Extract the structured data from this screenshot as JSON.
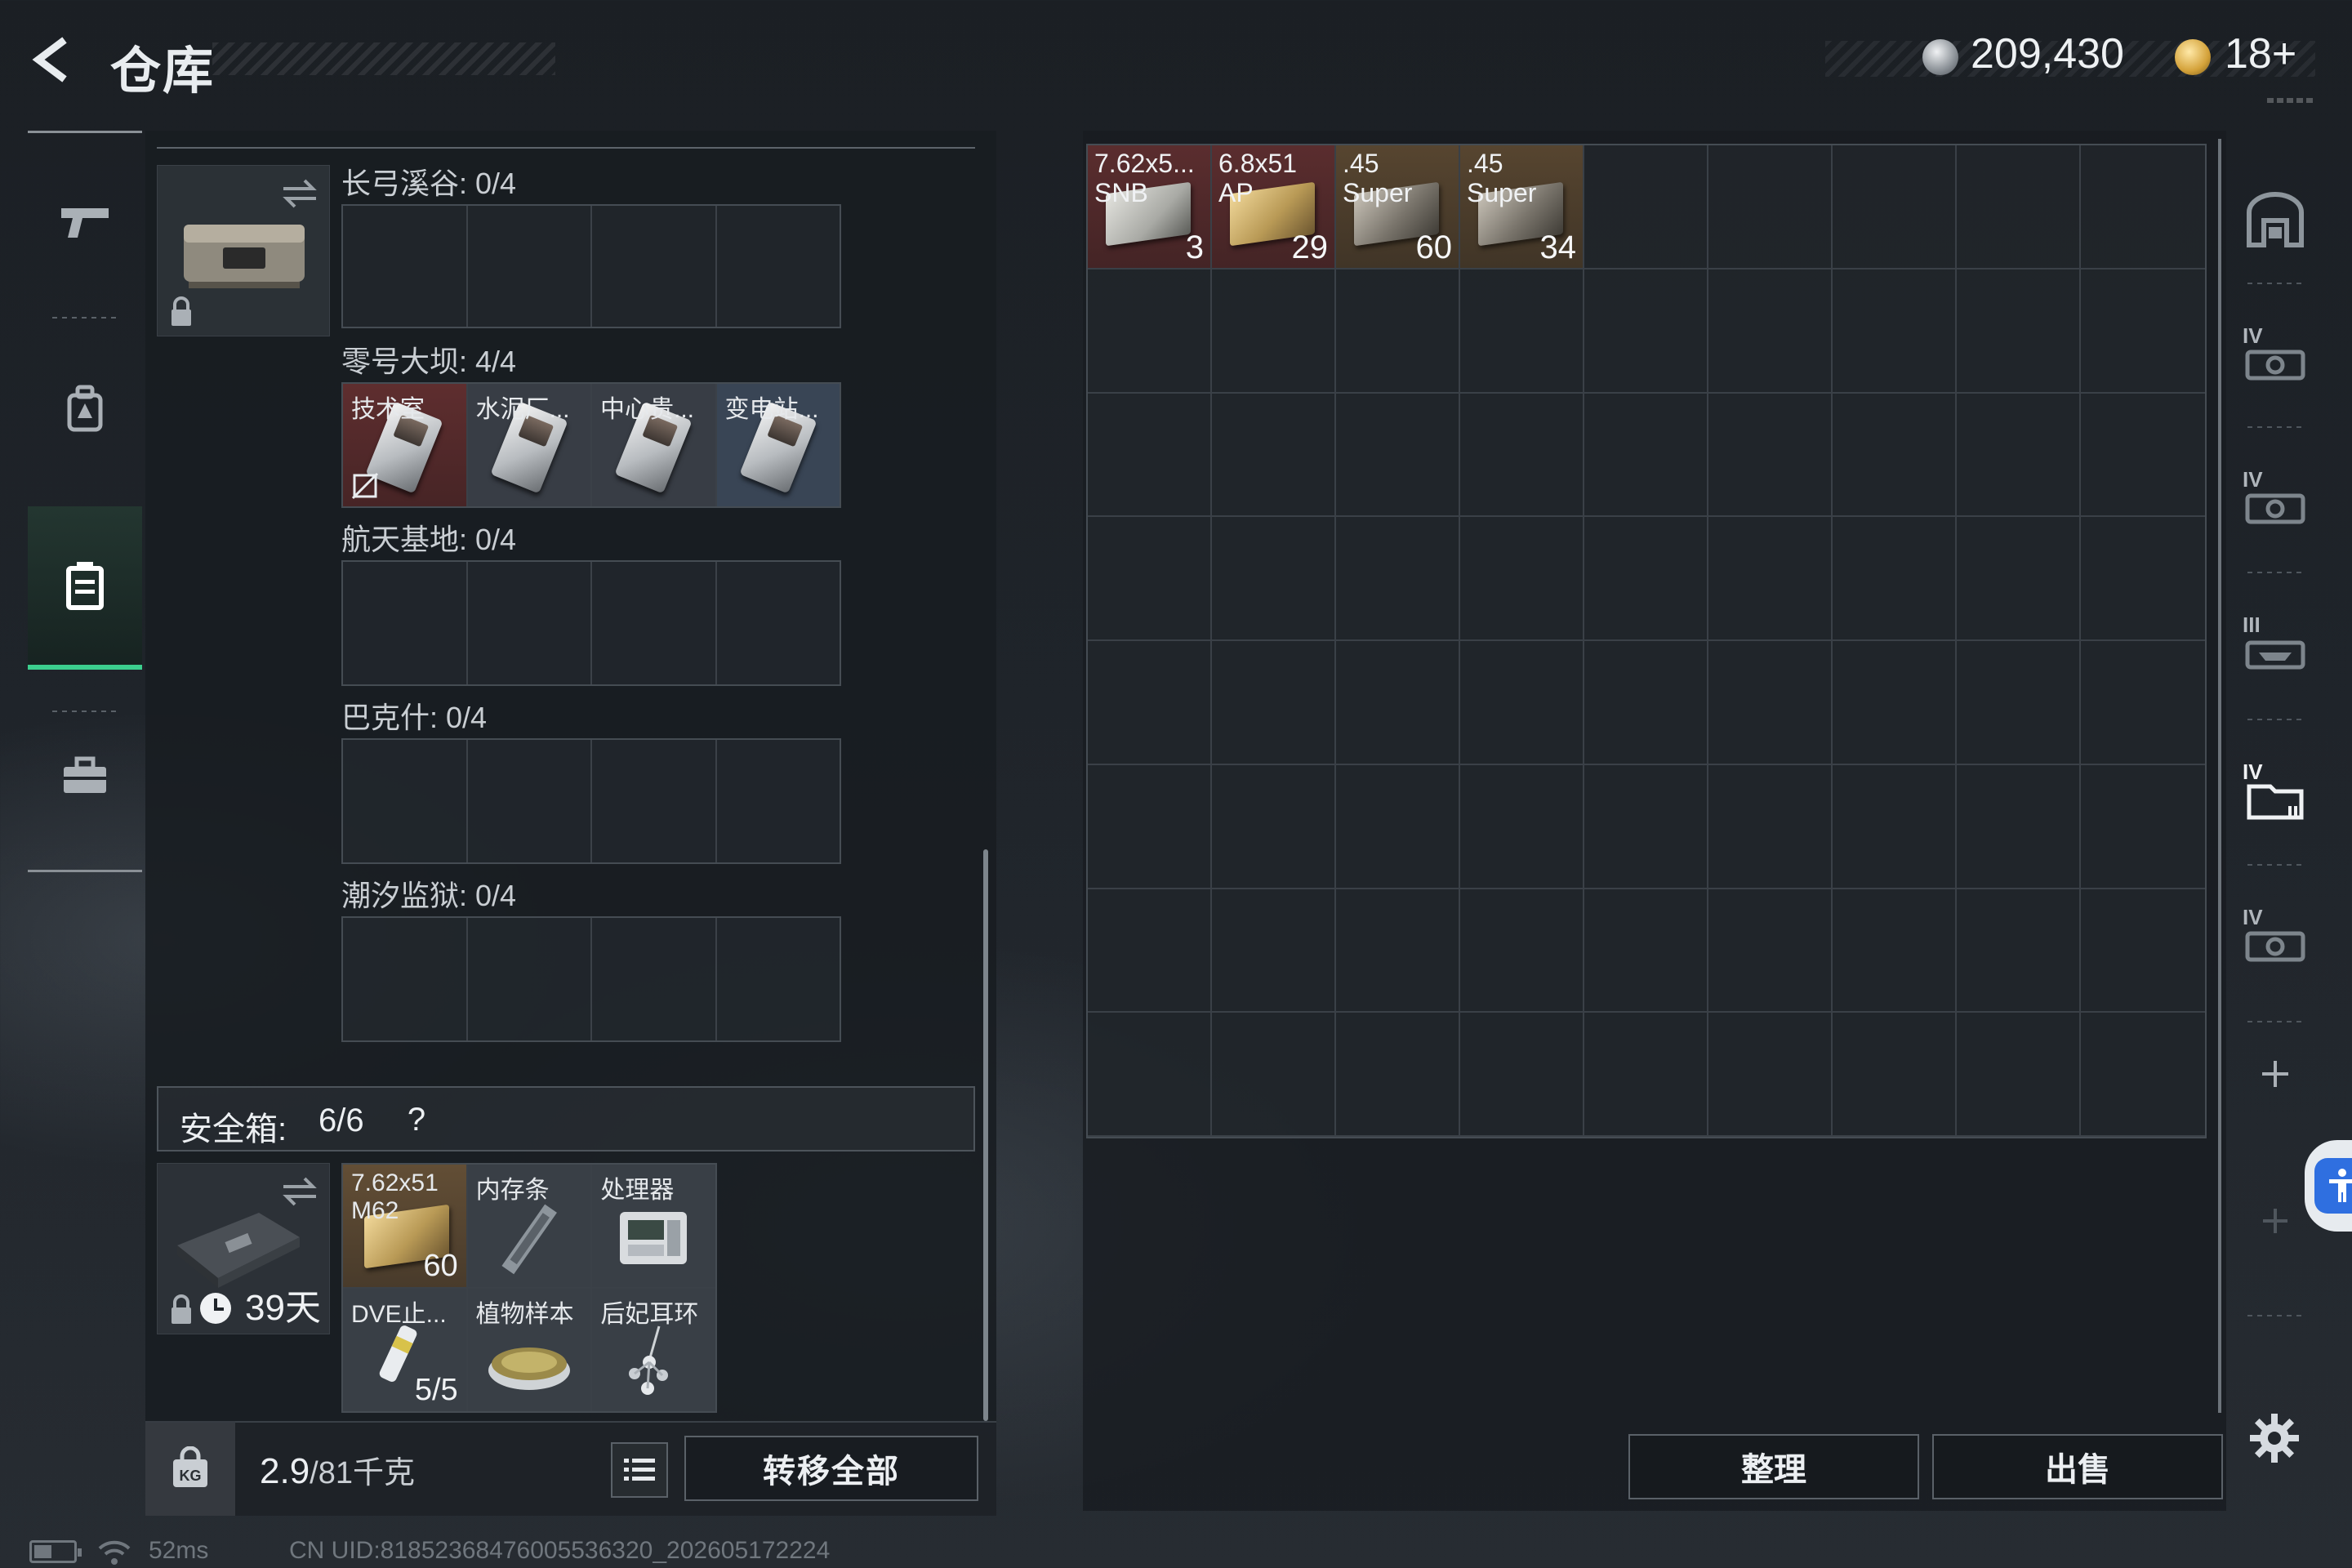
{
  "header": {
    "title": "仓库",
    "currency_1": "209,430",
    "currency_2": "18+"
  },
  "nav": {
    "items": [
      "weapons",
      "backpack",
      "storage",
      "toolbox"
    ],
    "active": "storage"
  },
  "key_sections": [
    {
      "label": "长弓溪谷: 0/4",
      "items": []
    },
    {
      "label": "零号大坝: 4/4",
      "items": [
        "技术室",
        "水泥厂...",
        "中心贵...",
        "变电站..."
      ]
    },
    {
      "label": "航天基地: 0/4",
      "items": []
    },
    {
      "label": "巴克什: 0/4",
      "items": []
    },
    {
      "label": "潮汐监狱: 0/4",
      "items": []
    }
  ],
  "safe_box": {
    "label": "安全箱:",
    "count": "6/6",
    "help": "?",
    "days": "39天",
    "items": [
      {
        "name": "7.62x51\nM62",
        "count": "60"
      },
      {
        "name": "内存条",
        "count": ""
      },
      {
        "name": "处理器",
        "count": ""
      },
      {
        "name": "DVE止...",
        "count": "5/5"
      },
      {
        "name": "植物样本",
        "count": ""
      },
      {
        "name": "后妃耳环",
        "count": ""
      }
    ]
  },
  "weight": {
    "current": "2.9",
    "max": "/81千克"
  },
  "buttons": {
    "transfer_all": "转移全部",
    "sort": "整理",
    "sell": "出售"
  },
  "stash": {
    "items": [
      {
        "name": "7.62x5...\nSNB",
        "count": "3",
        "tint": "red"
      },
      {
        "name": "6.8x51\nAP",
        "count": "29",
        "tint": "red"
      },
      {
        "name": ".45\nSuper",
        "count": "60",
        "tint": "amber"
      },
      {
        "name": ".45\nSuper",
        "count": "34",
        "tint": "amber"
      }
    ]
  },
  "right_bar": {
    "tiers": [
      "IV",
      "IV",
      "III",
      "IV",
      "IV"
    ]
  },
  "status": {
    "ping": "52ms",
    "uid": "CN UID:8185236847600553632​0_202605172224"
  },
  "colors": {
    "accent_green": "#3ccf8e",
    "red_tint": "#6e3030",
    "amber_tint": "#69503a",
    "access_blue": "#2f6fe0"
  }
}
